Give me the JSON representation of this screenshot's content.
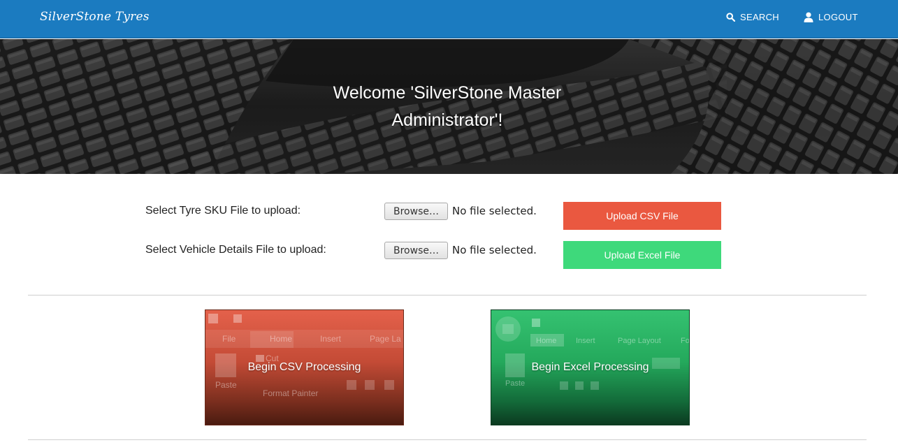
{
  "navbar": {
    "brand": "SilverStone Tyres",
    "search_label": "SEARCH",
    "logout_label": "LOGOUT",
    "color": "#1b7bc0"
  },
  "hero": {
    "title_line1": "Welcome 'SilverStone Master",
    "title_line2": "Administrator'!"
  },
  "uploads": {
    "tyre_sku_label": "Select Tyre SKU File to upload:",
    "vehicle_label": "Select Vehicle Details File to upload:",
    "browse_label": "Browse…",
    "no_file_text": "No file selected.",
    "csv_button": "Upload CSV File",
    "excel_button": "Upload Excel File",
    "csv_color": "#ea5840",
    "excel_color": "#3ed97b"
  },
  "tiles": {
    "csv_label": "Begin CSV Processing",
    "excel_label": "Begin Excel Processing",
    "csv_ribbon": {
      "tabs": [
        "File",
        "Home",
        "Insert",
        "Page La"
      ],
      "cut": "Cut",
      "paste": "Paste",
      "painter": "Format Painter"
    },
    "excel_ribbon": {
      "tabs": [
        "Home",
        "Insert",
        "Page Layout",
        "Fo"
      ],
      "paste": "Paste"
    }
  }
}
